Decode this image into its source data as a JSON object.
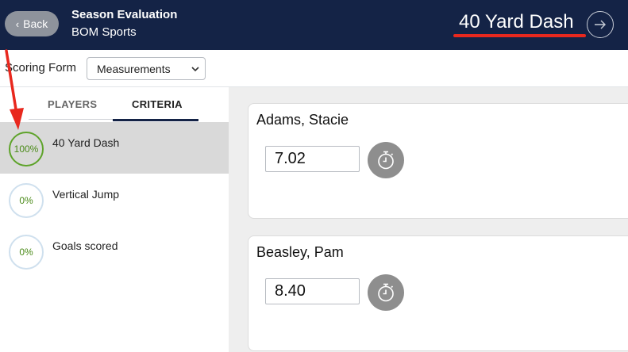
{
  "header": {
    "back_label": "Back",
    "title": "Season Evaluation",
    "subtitle": "BOM Sports",
    "current_criterion": "40 Yard Dash"
  },
  "scoring_form": {
    "label": "Scoring Form",
    "selected": "Measurements"
  },
  "tabs": [
    {
      "label": "PLAYERS",
      "active": false
    },
    {
      "label": "CRITERIA",
      "active": true
    }
  ],
  "criteria": [
    {
      "name": "40 Yard Dash",
      "percent": "100%",
      "active": true
    },
    {
      "name": "Vertical Jump",
      "percent": "0%",
      "active": false
    },
    {
      "name": "Goals scored",
      "percent": "0%",
      "active": false
    }
  ],
  "players": [
    {
      "name": "Adams, Stacie",
      "score": "7.02"
    },
    {
      "name": "Beasley, Pam",
      "score": "8.40"
    }
  ],
  "colors": {
    "header_bg": "#142346",
    "accent_red": "#e8281e",
    "complete_green": "#5ea32a",
    "timer_gray": "#8e8e8e"
  },
  "icons": {
    "back": "chevron-left-icon",
    "next": "arrow-right-icon",
    "select": "chevron-down-icon",
    "timer": "stopwatch-icon"
  }
}
